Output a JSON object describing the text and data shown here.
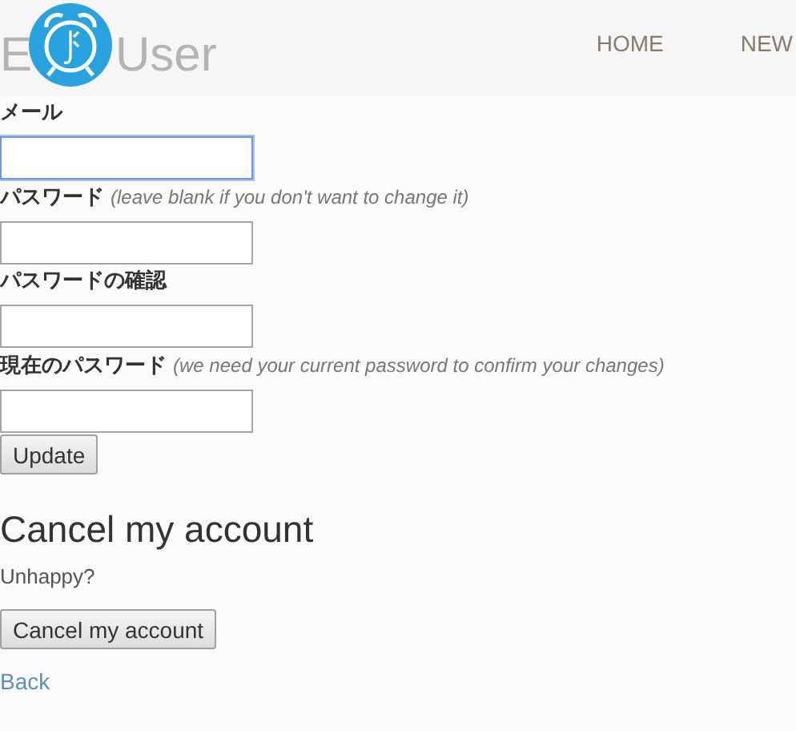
{
  "header": {
    "title_start": "E",
    "title_end": "User",
    "nav": [
      {
        "label": "HOME"
      },
      {
        "label": "NEW"
      }
    ]
  },
  "form": {
    "fields": [
      {
        "label": "メール",
        "focused": true
      },
      {
        "label": "パスワード",
        "hint": "(leave blank if you don't want to change it)",
        "focused": false
      },
      {
        "label": "パスワードの確認",
        "focused": false
      },
      {
        "label": "現在のパスワード",
        "hint": "(we need your current password to confirm your changes)",
        "focused": false
      }
    ],
    "submit": "Update"
  },
  "cancel": {
    "heading": "Cancel my account",
    "text": "Unhappy?",
    "button": "Cancel my account"
  },
  "back_link": "Back"
}
